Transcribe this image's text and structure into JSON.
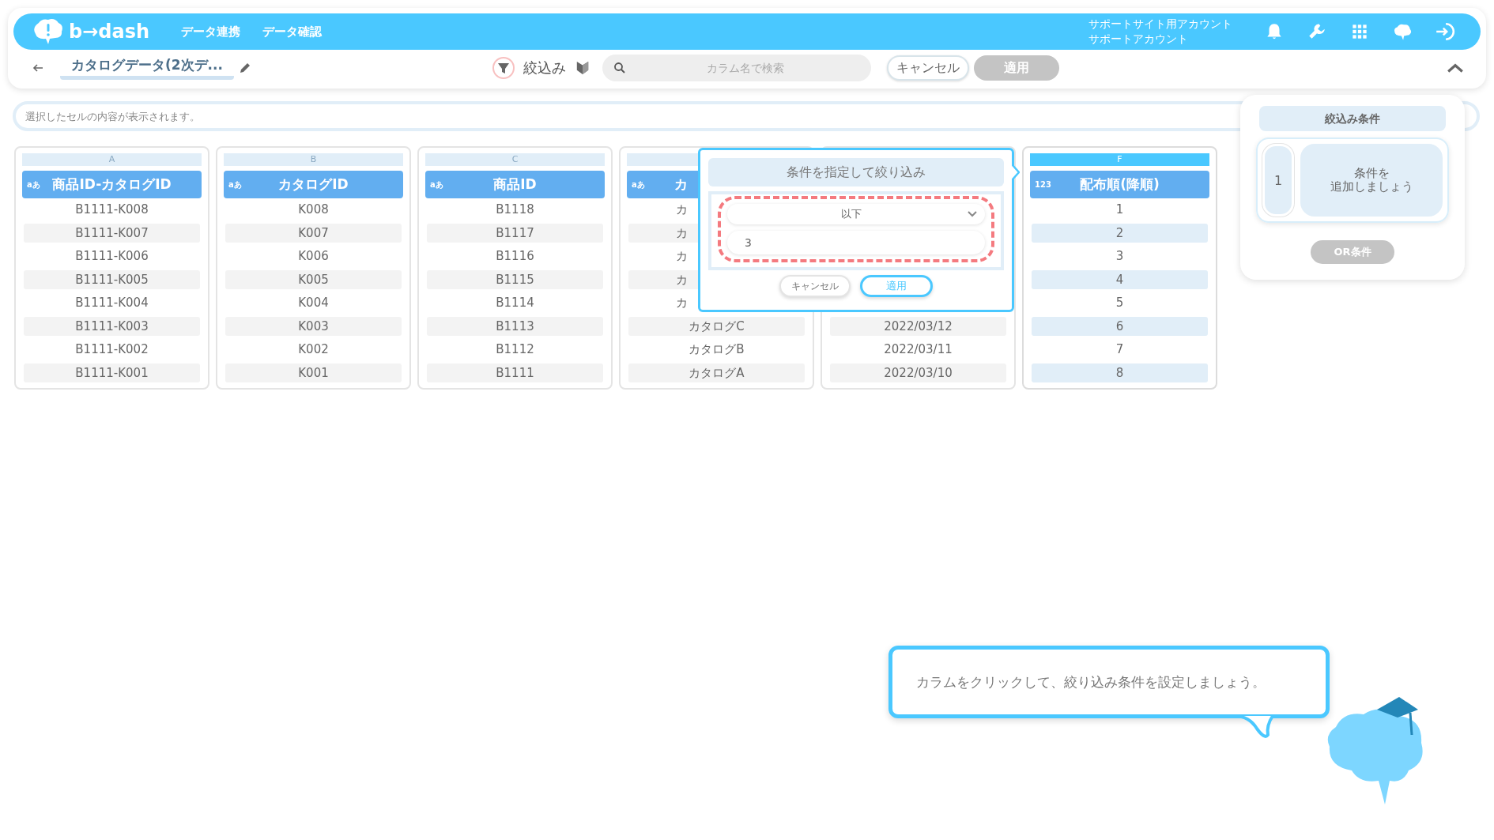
{
  "header": {
    "logo_text": "b→dash",
    "nav": [
      "データ連携",
      "データ確認"
    ],
    "account": [
      "サポートサイト用アカウント",
      "サポートアカウント"
    ]
  },
  "toolbar": {
    "title": "カタログデータ(2次デ...",
    "filter_label": "絞込み",
    "search": {
      "placeholder": "カラム名で検索"
    },
    "cancel": "キャンセル",
    "apply": {
      "label": "適用",
      "disabled": true
    }
  },
  "cell_info": {
    "placeholder": "選択したセルの内容が表示されます。"
  },
  "columns": [
    {
      "letter": "A",
      "type_icon": "aあ",
      "header": "商品ID-カタログID",
      "selected": false,
      "cells": [
        {
          "text": "B1111-K008"
        },
        {
          "text": "B1111-K007"
        },
        {
          "text": "B1111-K006"
        },
        {
          "text": "B1111-K005"
        },
        {
          "text": "B1111-K004"
        },
        {
          "text": "B1111-K003"
        },
        {
          "text": "B1111-K002"
        },
        {
          "text": "B1111-K001"
        }
      ]
    },
    {
      "letter": "B",
      "type_icon": "aあ",
      "header": "カタログID",
      "selected": false,
      "cells": [
        {
          "text": "K008"
        },
        {
          "text": "K007"
        },
        {
          "text": "K006"
        },
        {
          "text": "K005"
        },
        {
          "text": "K004"
        },
        {
          "text": "K003"
        },
        {
          "text": "K002"
        },
        {
          "text": "K001"
        }
      ]
    },
    {
      "letter": "C",
      "type_icon": "aあ",
      "header": "商品ID",
      "selected": false,
      "cells": [
        {
          "text": "B1118"
        },
        {
          "text": "B1117"
        },
        {
          "text": "B1116"
        },
        {
          "text": "B1115"
        },
        {
          "text": "B1114"
        },
        {
          "text": "B1113"
        },
        {
          "text": "B1112"
        },
        {
          "text": "B1111"
        }
      ]
    },
    {
      "type_icon": "aあ",
      "header": "カ",
      "header_cut": true,
      "selected": false,
      "cells": [
        {
          "text": "カ",
          "cut": true
        },
        {
          "text": "カ",
          "cut": true
        },
        {
          "text": "カ",
          "cut": true
        },
        {
          "text": "カ",
          "cut": true
        },
        {
          "text": "カ",
          "cut": true
        },
        {
          "text": "カタログC"
        },
        {
          "text": "カタログB"
        },
        {
          "text": "カタログA"
        }
      ]
    },
    {
      "cells": [
        {
          "text": "2022/03/12"
        },
        {
          "text": "2022/03/11"
        },
        {
          "text": "2022/03/10"
        }
      ]
    },
    {
      "letter": "F",
      "type_icon": "123",
      "header": "配布順(降順)",
      "selected": true,
      "cells": [
        {
          "text": "1"
        },
        {
          "text": "2"
        },
        {
          "text": "3"
        },
        {
          "text": "4"
        },
        {
          "text": "5"
        },
        {
          "text": "6"
        },
        {
          "text": "7"
        },
        {
          "text": "8"
        }
      ]
    }
  ],
  "popover": {
    "title": "条件を指定して絞り込み",
    "operator": "以下",
    "value": "3",
    "cancel": "キャンセル",
    "apply": "適用"
  },
  "conditions_panel": {
    "title": "絞込み条件",
    "groups": [
      {
        "index": "1",
        "lines": [
          "条件を",
          "追加しましょう"
        ]
      }
    ],
    "or_button": {
      "label": "OR条件",
      "disabled": true
    }
  },
  "hint": {
    "text": "カラムをクリックして、絞り込み条件を設定しましょう。"
  }
}
